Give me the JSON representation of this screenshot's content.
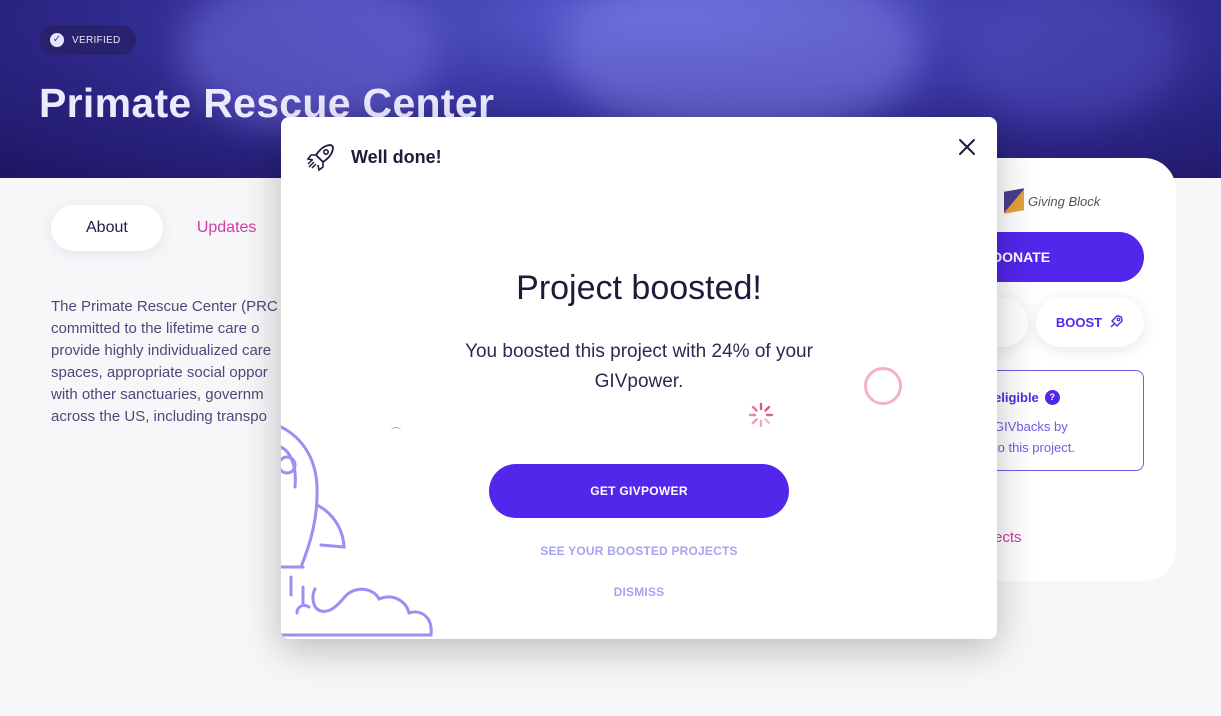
{
  "hero": {
    "badge": "VERIFIED",
    "title": "Primate Rescue Center"
  },
  "tabs": {
    "about": "About",
    "updates": "Updates"
  },
  "description": "The Primate Rescue Center (PR… committed to the lifetime care o… provide highly individualized care… spaces, appropriate social oppor… with other sanctuaries, governm… across the US, including transpo…",
  "description_lines": [
    "The Primate Rescue Center (PRC",
    "committed to the lifetime care o",
    "provide highly individualized care",
    "spaces, appropriate social oppor",
    "with other sanctuaries, governm",
    "across the US, including transpo"
  ],
  "sidebar": {
    "partner": "Giving Block",
    "donate": "DONATE",
    "boost": "BOOST",
    "eligible_title": "eligible",
    "eligible_text_1": "GIVbacks by",
    "eligible_text_2": "to this project.",
    "projects_link": "ects"
  },
  "modal": {
    "header": "Well done!",
    "title": "Project boosted!",
    "message": "You boosted this project with 24% of your GIVpower.",
    "primary_button": "GET GIVPOWER",
    "secondary_link": "SEE YOUR BOOSTED PROJECTS",
    "dismiss": "DISMISS"
  },
  "colors": {
    "primary": "#5326ec",
    "accent_pink": "#d33aa3",
    "hero_dark": "#2a2380"
  }
}
